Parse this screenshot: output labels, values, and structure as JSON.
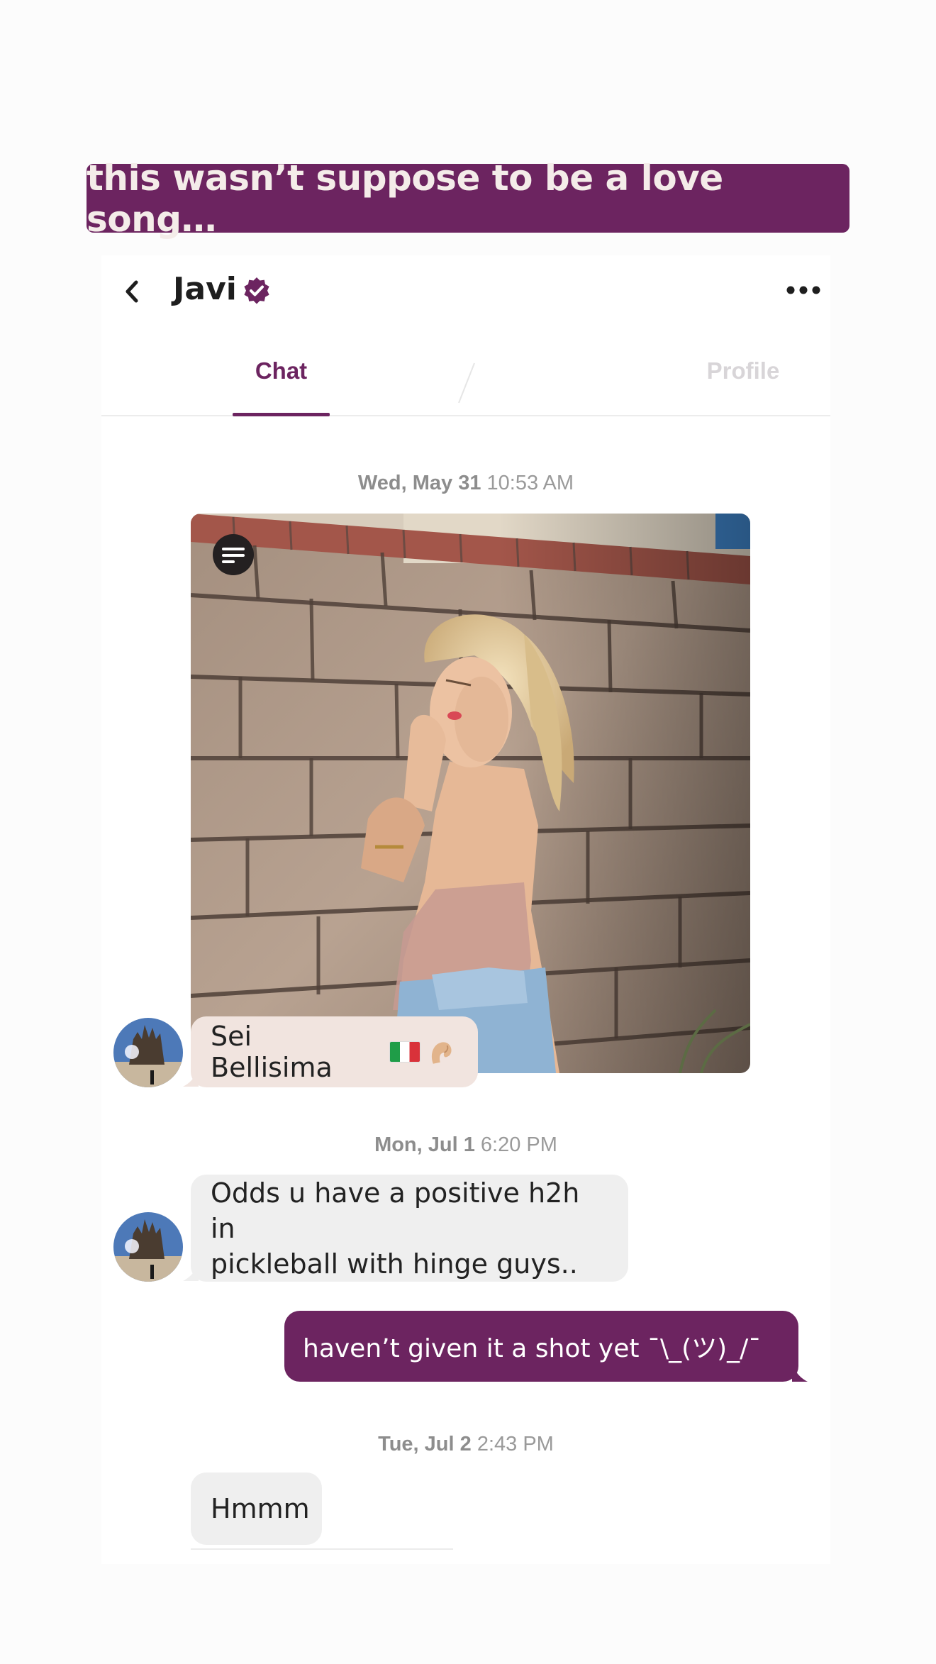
{
  "caption": "this wasn’t suppose to be a love song…",
  "header": {
    "contact_name": "Javi",
    "back_icon": "chevron-left-icon",
    "verified_icon": "verified-badge-icon",
    "more_icon": "more-horizontal-icon"
  },
  "tabs": [
    {
      "label": "Chat",
      "active": true
    },
    {
      "label": "Profile",
      "active": false
    }
  ],
  "conversation": {
    "groups": [
      {
        "date": "Wed, May 31",
        "time": "10:53 AM",
        "photo_icon": "prompt-lines-icon",
        "message": {
          "text": "Sei Bellisima",
          "emojis": [
            "flag-italy",
            "pinching-hand"
          ],
          "direction": "incoming"
        }
      },
      {
        "date": "Mon, Jul 1",
        "time": "6:20 PM",
        "message": {
          "line1": "Odds u have a positive h2h in",
          "line2": "pickleball with hinge guys..",
          "direction": "incoming"
        },
        "reply": {
          "text": "haven’t given it a shot yet ¯\\_(ツ)_/¯",
          "direction": "outgoing"
        }
      },
      {
        "date": "Tue, Jul 2",
        "time": "2:43 PM",
        "message": {
          "text": "Hmmm",
          "direction": "incoming"
        }
      }
    ]
  },
  "colors": {
    "brand": "#6c2460",
    "incoming_bubble": "#efefef",
    "tinted_bubble": "#f1e4df",
    "inactive_tab": "#d8d5d8"
  }
}
